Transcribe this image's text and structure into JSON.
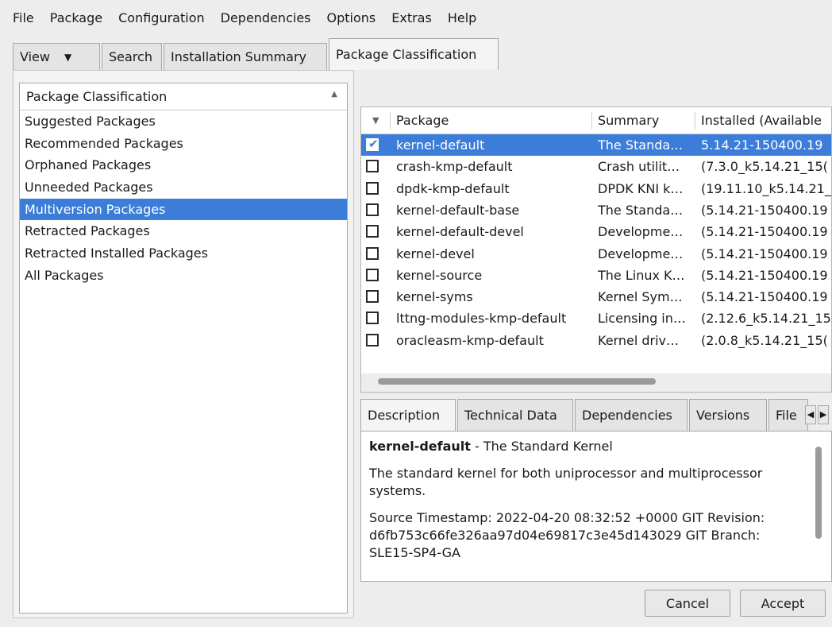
{
  "menu": [
    "File",
    "Package",
    "Configuration",
    "Dependencies",
    "Options",
    "Extras",
    "Help"
  ],
  "tabs": {
    "view": "View",
    "search": "Search",
    "installation_summary": "Installation Summary",
    "package_classification": "Package Classification"
  },
  "classification": {
    "header": "Package Classification",
    "items": [
      "Suggested Packages",
      "Recommended Packages",
      "Orphaned Packages",
      "Unneeded Packages",
      "Multiversion Packages",
      "Retracted Packages",
      "Retracted Installed Packages",
      "All Packages"
    ],
    "selected_index": 4
  },
  "table": {
    "headers": [
      "Package",
      "Summary",
      "Installed (Available"
    ],
    "rows": [
      {
        "checked": true,
        "name": "kernel-default",
        "summary": "The Standa…",
        "version": "5.14.21-150400.19"
      },
      {
        "checked": false,
        "name": "crash-kmp-default",
        "summary": "Crash utilit…",
        "version": "(7.3.0_k5.14.21_15("
      },
      {
        "checked": false,
        "name": "dpdk-kmp-default",
        "summary": "DPDK KNI k…",
        "version": "(19.11.10_k5.14.21_"
      },
      {
        "checked": false,
        "name": "kernel-default-base",
        "summary": "The Standa…",
        "version": "(5.14.21-150400.19"
      },
      {
        "checked": false,
        "name": "kernel-default-devel",
        "summary": "Developme…",
        "version": "(5.14.21-150400.19"
      },
      {
        "checked": false,
        "name": "kernel-devel",
        "summary": "Developme…",
        "version": "(5.14.21-150400.19"
      },
      {
        "checked": false,
        "name": "kernel-source",
        "summary": "The Linux K…",
        "version": "(5.14.21-150400.19"
      },
      {
        "checked": false,
        "name": "kernel-syms",
        "summary": "Kernel Sym…",
        "version": "(5.14.21-150400.19"
      },
      {
        "checked": false,
        "name": "lttng-modules-kmp-default",
        "summary": "Licensing in…",
        "version": "(2.12.6_k5.14.21_15"
      },
      {
        "checked": false,
        "name": "oracleasm-kmp-default",
        "summary": "Kernel driv…",
        "version": "(2.0.8_k5.14.21_15("
      }
    ]
  },
  "details": {
    "tabs": [
      "Description",
      "Technical Data",
      "Dependencies",
      "Versions",
      "File"
    ],
    "title_name": "kernel-default",
    "title_rest": " - The Standard Kernel",
    "para1": "The standard kernel for both uniprocessor and multiprocessor systems.",
    "para2": "Source Timestamp: 2022-04-20 08:32:52 +0000 GIT Revision: d6fb753c66fe326aa97d04e69817c3e45d143029 GIT Branch: SLE15-SP4-GA"
  },
  "buttons": {
    "cancel": "Cancel",
    "accept": "Accept"
  }
}
